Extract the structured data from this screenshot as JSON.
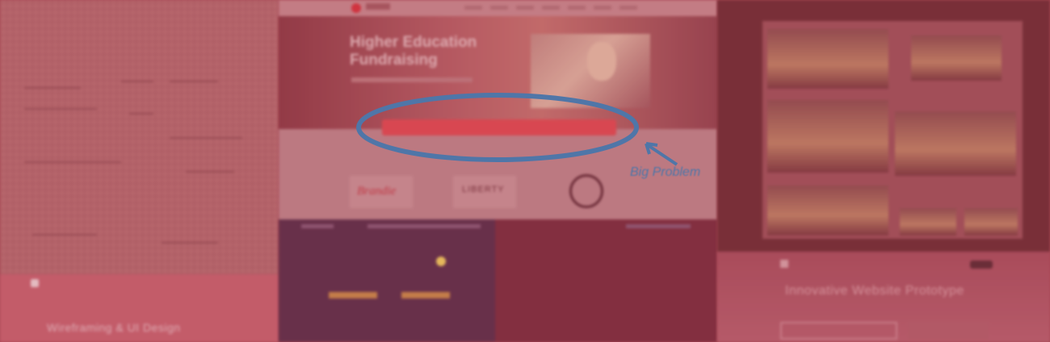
{
  "left_panel": {
    "caption": "Wireframing & UI Design"
  },
  "middle_panel": {
    "hero_title": "Higher Education Fundraising",
    "brands": [
      "Brandie",
      "LIBERTY"
    ]
  },
  "right_panel": {
    "subtitle": "Innovative Website Prototype"
  },
  "annotation": {
    "label": "Big Problem",
    "color": "#4f76a8"
  }
}
